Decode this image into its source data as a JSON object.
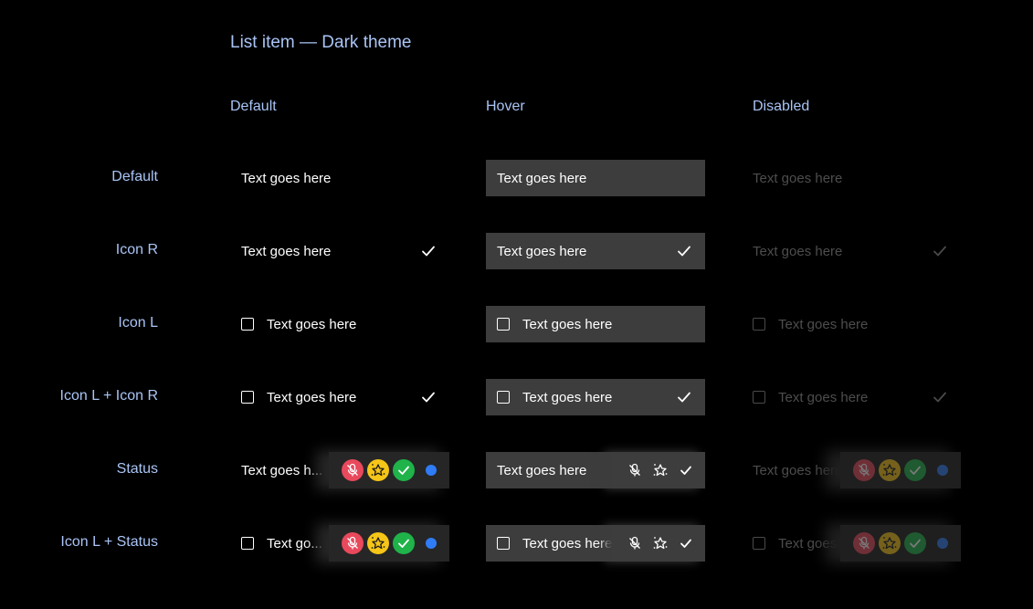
{
  "title": "List item — Dark theme",
  "columns": [
    "Default",
    "Hover",
    "Disabled"
  ],
  "rows": [
    "Default",
    "Icon R",
    "Icon L",
    "Icon L + Icon R",
    "Status",
    "Icon L + Status"
  ],
  "item_text": "Text goes here",
  "truncated": {
    "status_default": "Text goes h...",
    "iconl_status_default": "Text go...",
    "status_hover": "Text goes here",
    "iconl_status_hover": "Text goes here",
    "status_disabled": "Text goes here",
    "iconl_status_disabled": "Text goes here"
  },
  "status_icons": [
    "mic-off-icon",
    "sparkle-star-icon",
    "check-circle-icon",
    "dot-indicator"
  ],
  "colors": {
    "accent_label": "#a9c4f5",
    "hover_bg": "#3d3d3d",
    "mic_off_red": "#e8495c",
    "star_yellow": "#f5c518",
    "check_green": "#1fb34a",
    "dot_blue": "#2f7cf6"
  }
}
